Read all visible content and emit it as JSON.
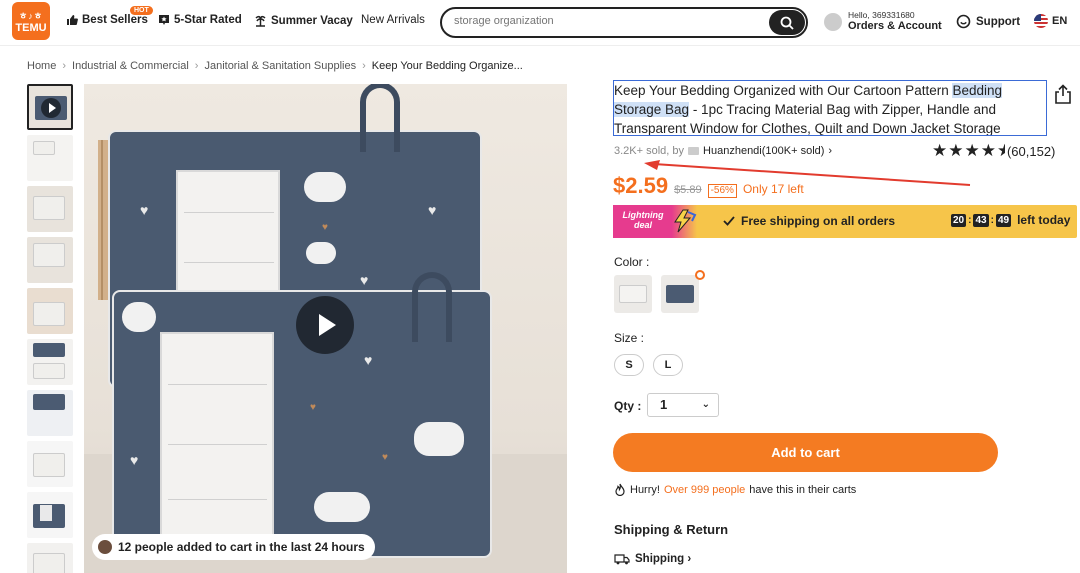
{
  "header": {
    "logo_top": "ㅎ♪ㅎ",
    "logo_bottom": "TEMU",
    "nav": [
      {
        "label": "Best Sellers",
        "badge": "HOT"
      },
      {
        "label": "5-Star Rated"
      },
      {
        "label": "Summer Vacay"
      },
      {
        "label": "New Arrivals"
      }
    ],
    "search_placeholder": "storage organization",
    "account_greeting": "Hello, 369331680",
    "account_label": "Orders & Account",
    "support_label": "Support",
    "lang_label": "EN"
  },
  "breadcrumb": [
    "Home",
    "Industrial & Commercial",
    "Janitorial & Sanitation Supplies",
    "Keep Your Bedding Organize..."
  ],
  "gallery": {
    "thumb_count": 10,
    "cart_notice": "12 people added to cart in the last 24 hours"
  },
  "product": {
    "title_pre": "Keep Your Bedding Organized with Our Cartoon Pattern ",
    "title_highlight": "Bedding Storage Bag",
    "title_post": " - 1pc Tracing Material Bag with Zipper, Handle and Transparent Window for Clothes, Quilt and Down Jacket Storage",
    "sold_text": "3.2K+ sold, by",
    "seller": "Huanzhendi(100K+ sold)",
    "seller_chevron": "›",
    "rating_stars": 4.5,
    "rating_count": "(60,152)",
    "price": "$2.59",
    "old_price": "$5.89",
    "discount": "-56%",
    "stock": "Only 17 left"
  },
  "deal": {
    "tag_line1": "Lightning",
    "tag_line2": "deal",
    "free_shipping": "Free shipping on all orders",
    "timer_h": "20",
    "timer_m": "43",
    "timer_s": "49",
    "timer_suffix": "left today"
  },
  "options": {
    "color_label": "Color :",
    "size_label": "Size :",
    "sizes": [
      "S",
      "L"
    ],
    "qty_label": "Qty :",
    "qty_value": "1"
  },
  "actions": {
    "add_to_cart": "Add to cart",
    "hurry_pre": "Hurry!",
    "hurry_orange": "Over 999 people",
    "hurry_post": "have this in their carts"
  },
  "shipping": {
    "section_title": "Shipping & Return",
    "shipping_label": "Shipping ›"
  },
  "colors": {
    "brand_orange": "#f46f1e",
    "deal_yellow": "#f6c54a",
    "deal_pink": "#e63b8e",
    "selection_blue": "#3b6bd6",
    "annotation_red": "#e23b2e"
  }
}
